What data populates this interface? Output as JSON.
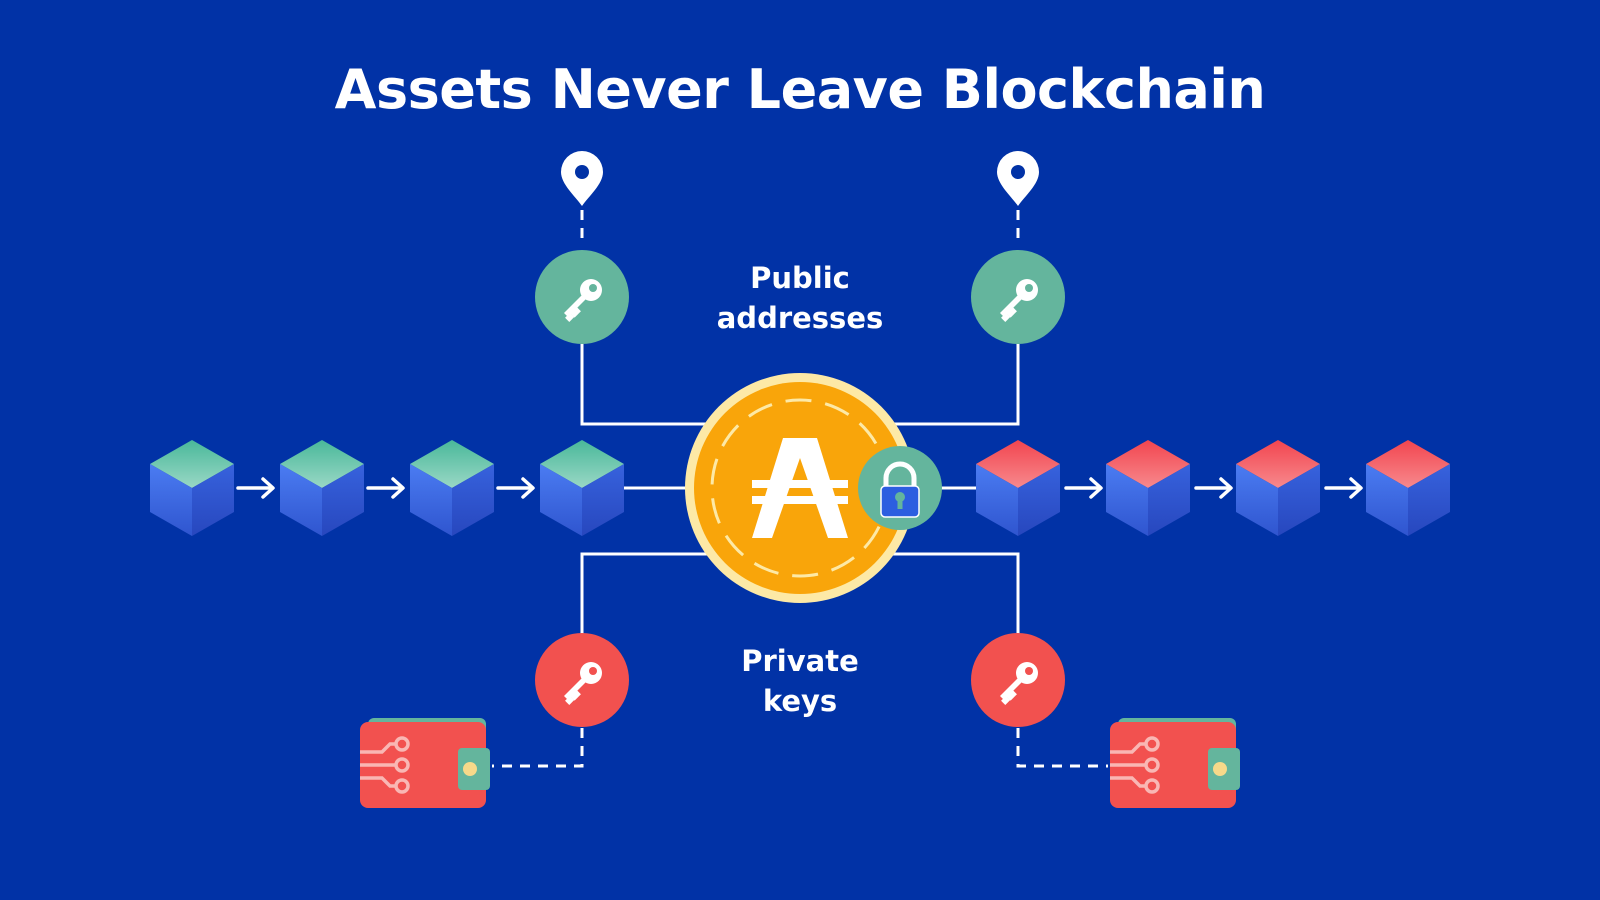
{
  "title": "Assets Never Leave Blockchain",
  "labels": {
    "public": [
      "Public",
      "addresses"
    ],
    "private": [
      "Private",
      "keys"
    ]
  },
  "colors": {
    "background": "#0132a6",
    "public_key": "#64b59d",
    "private_key": "#f2514f",
    "coin": "#f9a50a",
    "coin_rim": "#fde9a6",
    "wallet": "#f2514f",
    "cube_side": "#3f6ee8",
    "cube_top_green": "#5cc3a6",
    "cube_top_red": "#f5515a"
  },
  "icons": {
    "location_pin": "location-pin-icon",
    "key": "key-icon",
    "lock": "padlock-icon",
    "wallet": "wallet-icon",
    "coin": "coin-icon",
    "block": "cube-block-icon"
  }
}
